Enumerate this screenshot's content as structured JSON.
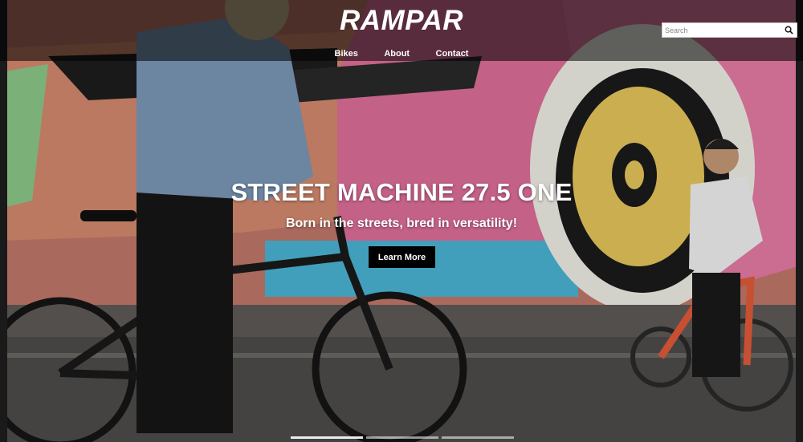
{
  "brand": {
    "logo": "RAMPAR"
  },
  "nav": {
    "items": [
      "Bikes",
      "About",
      "Contact"
    ]
  },
  "search": {
    "placeholder": "Search",
    "icon": "magnifier"
  },
  "hero": {
    "title": "STREET MACHINE 27.5 ONE",
    "subtitle": "Born in the streets, bred in versatility!",
    "cta_label": "Learn More",
    "image_desc": "Two riders on bikes in front of a painted brick mural",
    "slides": 3,
    "active_slide": 1
  },
  "colors": {
    "header_overlay": "#000000",
    "cta_bg": "#000000",
    "mural_pink": "#e06f9a",
    "mural_peach": "#e8946a",
    "mural_yellow": "#e8c75a",
    "mural_blue": "#4bb6d6"
  }
}
